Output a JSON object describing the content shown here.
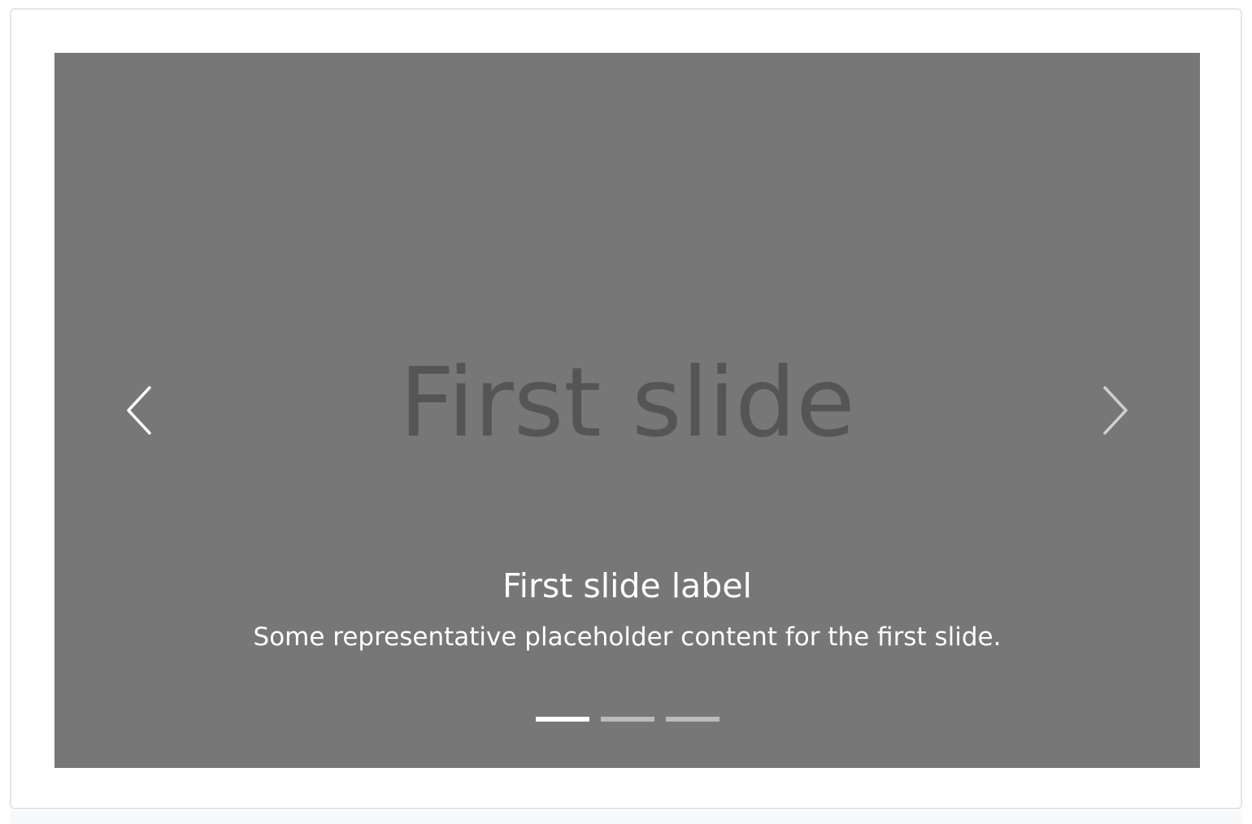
{
  "carousel": {
    "placeholder_text": "First slide",
    "caption": {
      "title": "First slide label",
      "text": "Some representative placeholder content for the first slide."
    },
    "controls": {
      "prev_icon": "chevron-left-icon",
      "next_icon": "chevron-right-icon"
    },
    "indicators": {
      "count": 3,
      "active_index": 0
    },
    "colors": {
      "slide_background": "#777777",
      "placeholder_text": "#555555",
      "caption_text": "#ffffff"
    }
  }
}
